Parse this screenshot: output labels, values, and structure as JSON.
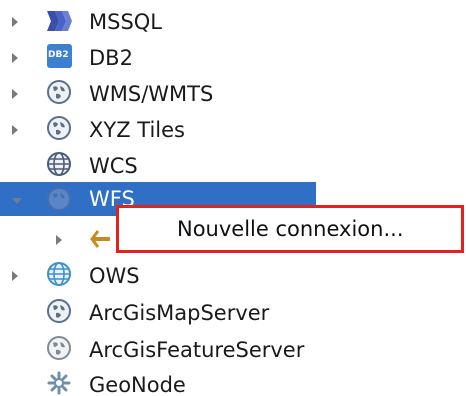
{
  "tree": {
    "items": [
      {
        "label": "MSSQL",
        "icon": "mssql-icon",
        "expander": "collapsed"
      },
      {
        "label": "DB2",
        "icon": "db2-icon",
        "badge": "DB2",
        "expander": "collapsed"
      },
      {
        "label": "WMS/WMTS",
        "icon": "globe-icon",
        "expander": "collapsed"
      },
      {
        "label": "XYZ Tiles",
        "icon": "globe-icon",
        "expander": "collapsed"
      },
      {
        "label": "WCS",
        "icon": "globe-icon",
        "expander": "none"
      },
      {
        "label": "WFS",
        "icon": "globe-icon",
        "expander": "expanded",
        "selected": true
      },
      {
        "label": "",
        "icon": "connection-icon",
        "expander": "collapsed"
      },
      {
        "label": "OWS",
        "icon": "globe-icon",
        "expander": "collapsed"
      },
      {
        "label": "ArcGisMapServer",
        "icon": "globe-icon",
        "expander": "none"
      },
      {
        "label": "ArcGisFeatureServer",
        "icon": "globe-icon",
        "expander": "none"
      },
      {
        "label": "GeoNode",
        "icon": "geonode-icon",
        "expander": "none"
      }
    ]
  },
  "context_menu": {
    "items": [
      {
        "label": "Nouvelle connexion..."
      }
    ]
  },
  "colors": {
    "selection": "#2f6fc5",
    "highlight_border": "#e2231a"
  }
}
